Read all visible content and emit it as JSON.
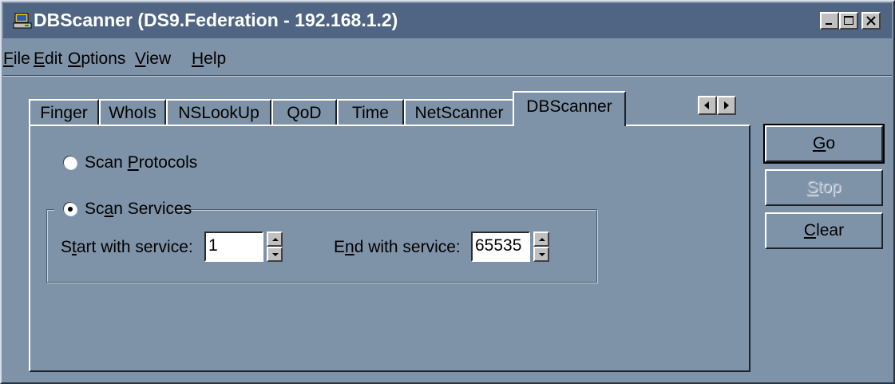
{
  "window": {
    "title": "DBScanner (DS9.Federation - 192.168.1.2)",
    "icon": "network-scanner-icon",
    "caption_buttons": [
      "minimize",
      "maximize",
      "close"
    ]
  },
  "menu": [
    {
      "pre": "",
      "key": "F",
      "post": "ile"
    },
    {
      "pre": "",
      "key": "E",
      "post": "dit"
    },
    {
      "pre": "",
      "key": "O",
      "post": "ptions"
    },
    {
      "pre": "",
      "key": "V",
      "post": "iew"
    },
    {
      "pre": "",
      "key": "H",
      "post": "elp"
    }
  ],
  "tabs": [
    {
      "label": "Finger"
    },
    {
      "label": "WhoIs"
    },
    {
      "label": "NSLookUp"
    },
    {
      "label": "QoD"
    },
    {
      "label": "Time"
    },
    {
      "label": "NetScanner"
    },
    {
      "label": "DBScanner",
      "selected": true
    }
  ],
  "scan_protocols": {
    "pre": "Scan ",
    "key": "P",
    "post": "rotocols",
    "checked": false
  },
  "scan_services": {
    "pre": "Sc",
    "key": "a",
    "post": "n Services",
    "checked": true
  },
  "start_service": {
    "label_pre": "S",
    "label_key": "t",
    "label_post": "art with service:",
    "value": "1"
  },
  "end_service": {
    "label_pre": "E",
    "label_key": "n",
    "label_post": "d with service:",
    "value": "65535"
  },
  "buttons": {
    "go": {
      "pre": "",
      "key": "G",
      "post": "o"
    },
    "stop": {
      "pre": "",
      "key": "S",
      "post": "top",
      "disabled": true
    },
    "clear": {
      "pre": "",
      "key": "C",
      "post": "lear"
    }
  }
}
